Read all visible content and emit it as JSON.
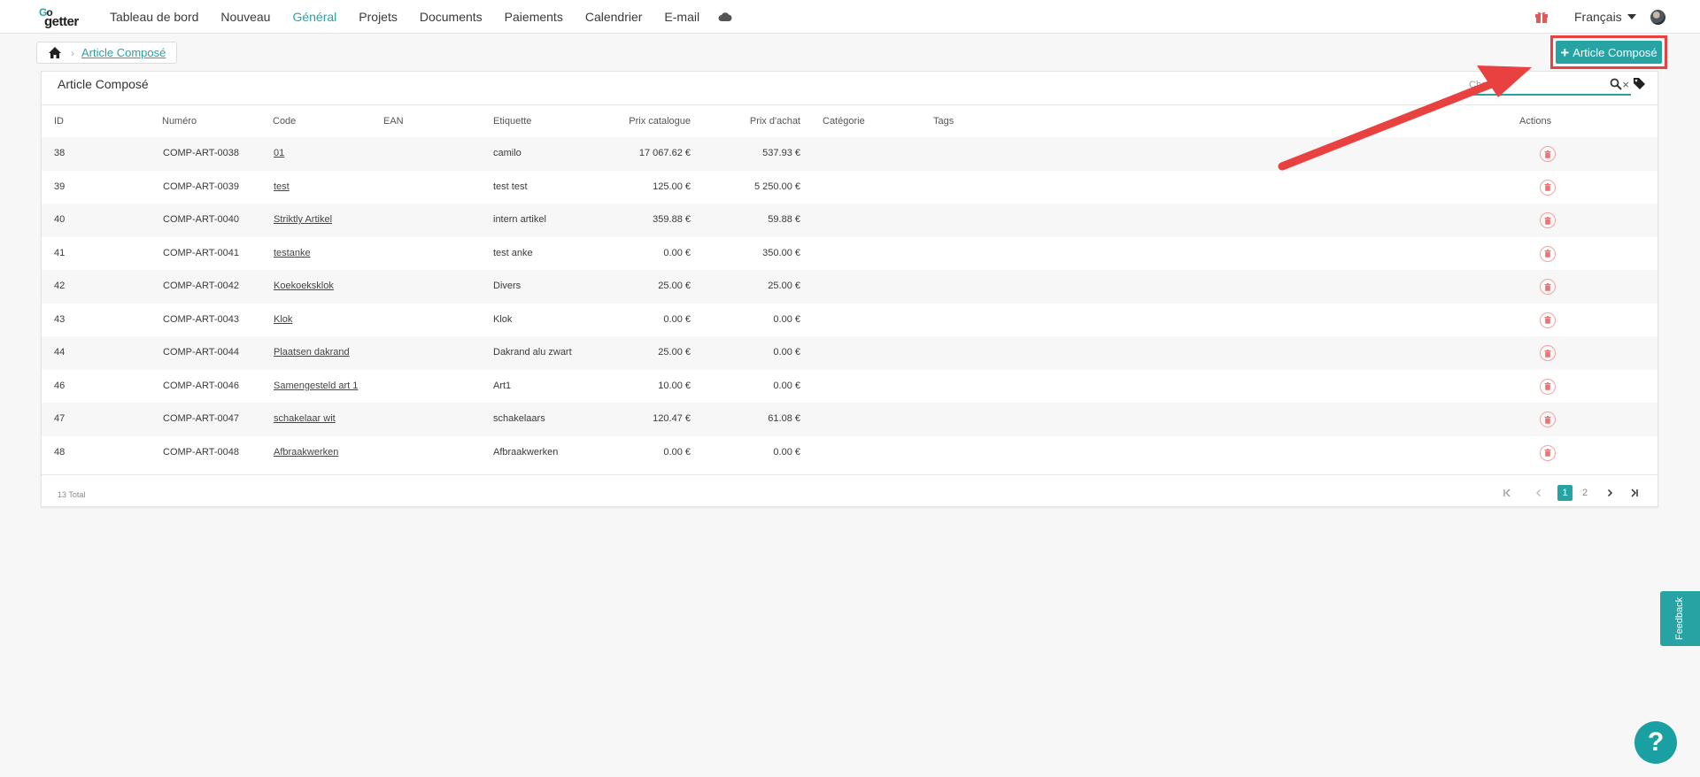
{
  "nav": {
    "logo_go": "Go",
    "logo_getter": "getter",
    "items": [
      "Tableau de bord",
      "Nouveau",
      "Général",
      "Projets",
      "Documents",
      "Paiements",
      "Calendrier",
      "E-mail"
    ],
    "active": "Général",
    "language": "Français"
  },
  "breadcrumb": {
    "current": "Article Composé"
  },
  "add_button": {
    "label": "Article Composé",
    "plus": "+"
  },
  "card": {
    "title": "Article Composé",
    "search_placeholder": "Chercher",
    "clear": "×"
  },
  "table": {
    "columns": [
      "ID",
      "Numéro",
      "Code",
      "EAN",
      "Etiquette",
      "Prix catalogue",
      "Prix d'achat",
      "Catégorie",
      "Tags",
      "Actions"
    ],
    "rows": [
      {
        "id": "38",
        "numero": "COMP-ART-0038",
        "code": "01",
        "ean": "",
        "etiquette": "camilo",
        "prix_catalogue": "17 067.62 €",
        "prix_achat": "537.93 €",
        "categorie": "",
        "tags": ""
      },
      {
        "id": "39",
        "numero": "COMP-ART-0039",
        "code": "test",
        "ean": "",
        "etiquette": "test test",
        "prix_catalogue": "125.00 €",
        "prix_achat": "5 250.00 €",
        "categorie": "",
        "tags": ""
      },
      {
        "id": "40",
        "numero": "COMP-ART-0040",
        "code": "Striktly Artikel",
        "ean": "",
        "etiquette": "intern artikel",
        "prix_catalogue": "359.88 €",
        "prix_achat": "59.88 €",
        "categorie": "",
        "tags": ""
      },
      {
        "id": "41",
        "numero": "COMP-ART-0041",
        "code": "testanke",
        "ean": "",
        "etiquette": "test anke",
        "prix_catalogue": "0.00 €",
        "prix_achat": "350.00 €",
        "categorie": "",
        "tags": ""
      },
      {
        "id": "42",
        "numero": "COMP-ART-0042",
        "code": "Koekoeksklok",
        "ean": "",
        "etiquette": "Divers",
        "prix_catalogue": "25.00 €",
        "prix_achat": "25.00 €",
        "categorie": "",
        "tags": ""
      },
      {
        "id": "43",
        "numero": "COMP-ART-0043",
        "code": "Klok",
        "ean": "",
        "etiquette": "Klok",
        "prix_catalogue": "0.00 €",
        "prix_achat": "0.00 €",
        "categorie": "",
        "tags": ""
      },
      {
        "id": "44",
        "numero": "COMP-ART-0044",
        "code": "Plaatsen dakrand",
        "ean": "",
        "etiquette": "Dakrand alu zwart",
        "prix_catalogue": "25.00 €",
        "prix_achat": "0.00 €",
        "categorie": "",
        "tags": ""
      },
      {
        "id": "46",
        "numero": "COMP-ART-0046",
        "code": "Samengesteld art 1",
        "ean": "",
        "etiquette": "Art1",
        "prix_catalogue": "10.00 €",
        "prix_achat": "0.00 €",
        "categorie": "",
        "tags": ""
      },
      {
        "id": "47",
        "numero": "COMP-ART-0047",
        "code": "schakelaar wit",
        "ean": "",
        "etiquette": "schakelaars",
        "prix_catalogue": "120.47 €",
        "prix_achat": "61.08 €",
        "categorie": "",
        "tags": ""
      },
      {
        "id": "48",
        "numero": "COMP-ART-0048",
        "code": "Afbraakwerken",
        "ean": "",
        "etiquette": "Afbraakwerken",
        "prix_catalogue": "0.00 €",
        "prix_achat": "0.00 €",
        "categorie": "",
        "tags": ""
      }
    ]
  },
  "footer": {
    "total": "13 Total",
    "pages": [
      "1",
      "2"
    ],
    "current_page": "1"
  },
  "feedback": "Feedback",
  "help": "?",
  "colors": {
    "accent": "#27a3a3",
    "highlight": "#e8413f",
    "delete": "#f2a3a3"
  }
}
